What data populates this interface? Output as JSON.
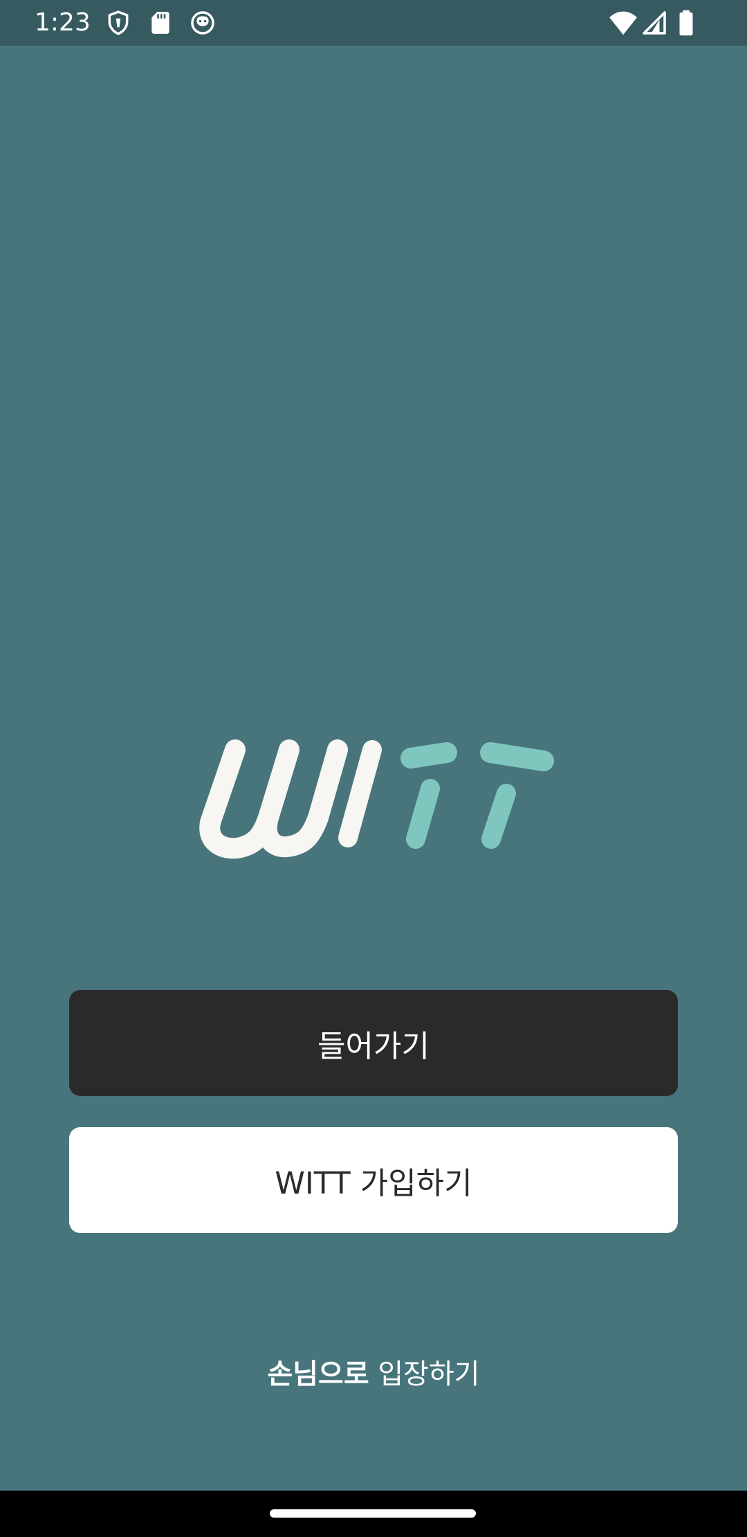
{
  "status_bar": {
    "time": "1:23",
    "icons_left": [
      "shield-icon",
      "sd-card-icon",
      "cat-face-icon"
    ],
    "icons_right": [
      "wifi-icon",
      "cell-signal-icon",
      "battery-icon"
    ]
  },
  "logo": {
    "text": "WITT",
    "colors": {
      "wi": "#F8F6F2",
      "tt": "#7FC6BE"
    }
  },
  "buttons": {
    "login_label": "들어가기",
    "signup_label": "WITT 가입하기"
  },
  "guest": {
    "strong": "손님으로",
    "rest": " 입장하기"
  },
  "colors": {
    "background": "#47757B",
    "status_bar": "#365A60",
    "login_button": "#2A2A2B",
    "signup_button": "#FFFFFF"
  }
}
